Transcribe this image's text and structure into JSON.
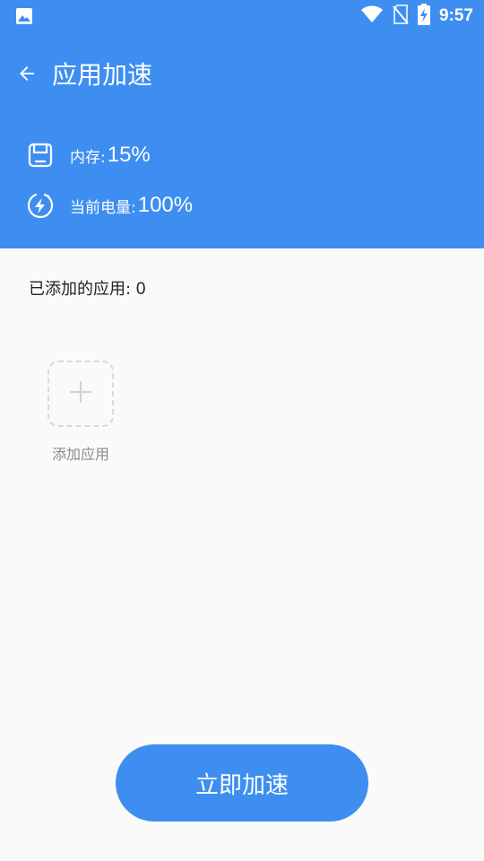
{
  "status_bar": {
    "time": "9:57",
    "icons": [
      "image-icon",
      "wifi-icon",
      "no-sim-icon",
      "battery-charging-icon"
    ]
  },
  "toolbar": {
    "title": "应用加速",
    "back_icon": "arrow-left-icon"
  },
  "stats": {
    "memory": {
      "icon": "memory-card-icon",
      "label": "内存:",
      "value": "15%"
    },
    "battery": {
      "icon": "battery-bolt-icon",
      "label": "当前电量:",
      "value": "100%"
    }
  },
  "apps": {
    "added_label": "已添加的应用:",
    "added_count": "0",
    "add_label": "添加应用",
    "add_icon": "plus-icon"
  },
  "actions": {
    "boost_label": "立即加速"
  },
  "colors": {
    "primary": "#3d8ef0",
    "background": "#fafafa",
    "text_dark": "#222222",
    "text_muted": "#8a8a8a",
    "dashed_border": "#d9d9d9"
  }
}
